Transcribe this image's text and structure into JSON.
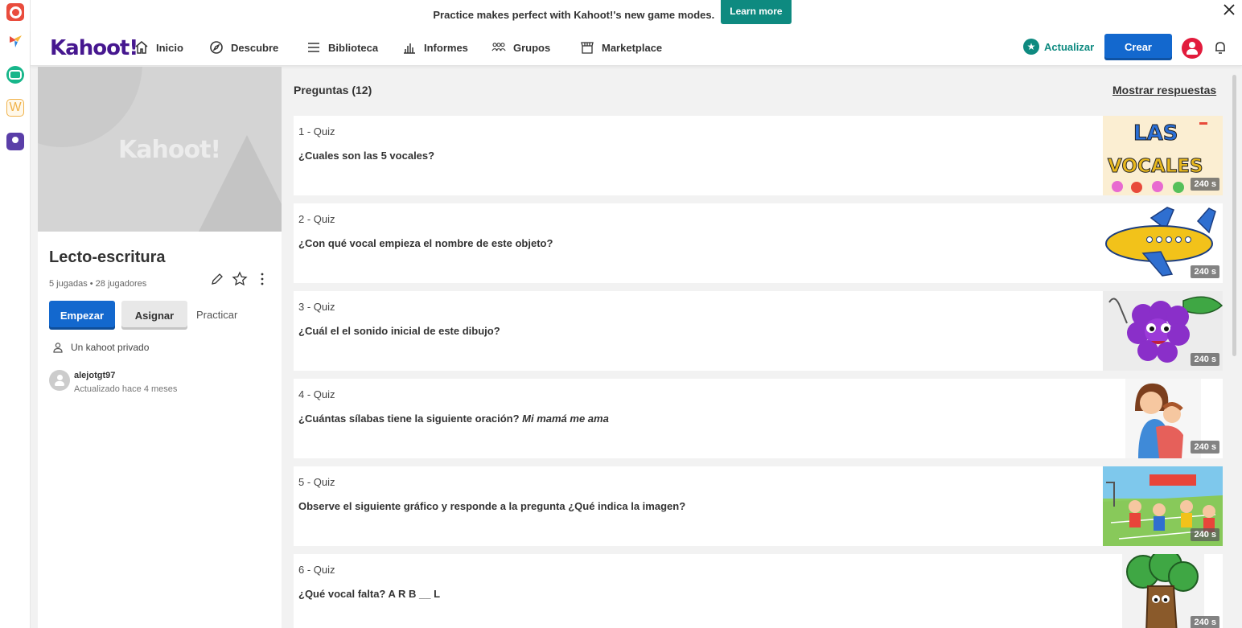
{
  "banner": {
    "text": "Practice makes perfect with Kahoot!'s new game modes.",
    "cta": "Learn more"
  },
  "nav": {
    "logo": "Kahoot!",
    "items": [
      "Inicio",
      "Descubre",
      "Biblioteca",
      "Informes",
      "Grupos",
      "Marketplace"
    ],
    "upgrade": "Actualizar",
    "create": "Crear"
  },
  "kahoot": {
    "cover_logo": "Kahoot!",
    "title": "Lecto-escritura",
    "meta": "5 jugadas • 28 jugadores",
    "start": "Empezar",
    "assign": "Asignar",
    "practice": "Practicar",
    "visibility": "Un kahoot privado",
    "author": "alejotgt97",
    "updated": "Actualizado hace 4 meses"
  },
  "questions_header": "Preguntas (12)",
  "show_answers": "Mostrar respuestas",
  "questions": [
    {
      "num": "1 - Quiz",
      "text": "¿Cuales son las 5 vocales?",
      "time": "240 s",
      "image": "vocales-image"
    },
    {
      "num": "2 - Quiz",
      "text": "¿Con qué vocal empieza el nombre de este objeto?",
      "time": "240 s",
      "image": "airplane-image"
    },
    {
      "num": "3 - Quiz",
      "text": "¿Cuál el el sonido inicial de este dibujo?",
      "time": "240 s",
      "image": "grapes-image"
    },
    {
      "num": "4 - Quiz",
      "text": "¿Cuántas sílabas tiene la siguiente oración?",
      "text_italic": "Mi mamá me ama",
      "time": "240 s",
      "image": "mother-child-image"
    },
    {
      "num": "5 - Quiz",
      "text": "Observe el siguiente gráfico y responde a la pregunta ¿Qué indica la imagen?",
      "time": "240 s",
      "image": "kids-playground-image"
    },
    {
      "num": "6 - Quiz",
      "text": "¿Qué vocal falta? A R B __ L",
      "time": "240 s",
      "image": "tree-image"
    }
  ],
  "colors": {
    "brand": "#46178f",
    "primary": "#1368ce",
    "accent": "#0e8a80",
    "avatar": "#e21b3c"
  }
}
